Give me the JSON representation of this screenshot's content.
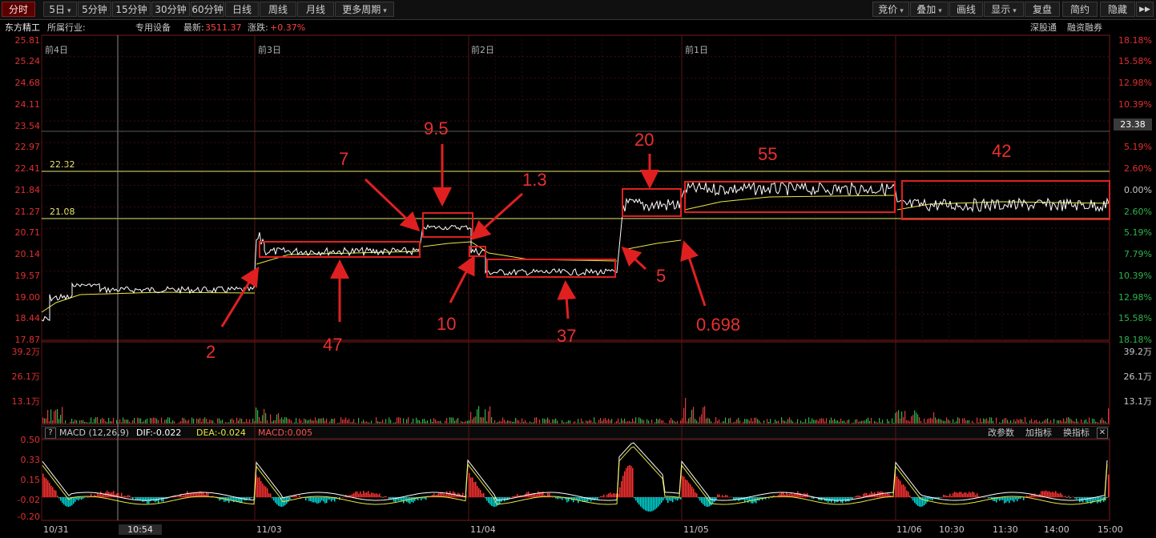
{
  "toolbar": {
    "left_tabs": [
      "分时",
      "5日",
      "5分钟",
      "15分钟",
      "30分钟",
      "60分钟",
      "日线",
      "周线",
      "月线",
      "更多周期"
    ],
    "right_tabs": [
      "竞价",
      "叠加",
      "画线",
      "显示",
      "复盘",
      "简约",
      "隐藏"
    ]
  },
  "info": {
    "name": "东方精工",
    "industry_label": "所属行业:",
    "industry": "专用设备",
    "latest_label": "最新:",
    "latest": "3511.37",
    "change_label": "涨跌:",
    "change": "+0.37%",
    "links": [
      "深股通",
      "融资融券"
    ]
  },
  "price_axis": {
    "left": [
      "25.81",
      "25.24",
      "24.68",
      "24.11",
      "23.54",
      "22.97",
      "22.41",
      "21.84",
      "21.27",
      "20.71",
      "20.14",
      "19.57",
      "19.00",
      "18.44",
      "17.87"
    ],
    "right": [
      "18.18%",
      "15.58%",
      "12.98%",
      "10.39%",
      "7.79%",
      "5.19%",
      "2.60%",
      "0.00%",
      "2.60%",
      "5.19%",
      "7.79%",
      "10.39%",
      "12.98%",
      "15.58%",
      "18.18%"
    ],
    "current_price_tag": "23.38",
    "hline_upper_label": "22.32",
    "hline_lower_label": "21.08"
  },
  "day_labels": [
    "前4日",
    "前3日",
    "前2日",
    "前1日"
  ],
  "volume_axis": [
    "39.2万",
    "26.1万",
    "13.1万"
  ],
  "macd": {
    "help": "?",
    "title": "MACD (12,26,9)",
    "dif": "DIF:-0.022",
    "dea": "DEA:-0.024",
    "macd": "MACD:0.005",
    "links": [
      "改参数",
      "加指标",
      "换指标"
    ],
    "close": "✕",
    "axis": [
      "0.50",
      "0.33",
      "0.15",
      "-0.02",
      "-0.20"
    ]
  },
  "x_axis": [
    "10/31",
    "10:54",
    "11/03",
    "11/04",
    "11/05",
    "11/06",
    "10:30",
    "11:30",
    "14:00",
    "15:00"
  ],
  "annotations": [
    "9.5",
    "7",
    "1.3",
    "20",
    "55",
    "42",
    "2",
    "47",
    "10",
    "37",
    "5",
    "0.698"
  ],
  "colors": {
    "up": "#ff3232",
    "down": "#00d8d8",
    "vol_up": "#e03a3a",
    "vol_down": "#2fb34a",
    "hline": "#e8e870",
    "box": "#e02020",
    "price": "#ffffff",
    "avg": "#e8e840"
  }
}
